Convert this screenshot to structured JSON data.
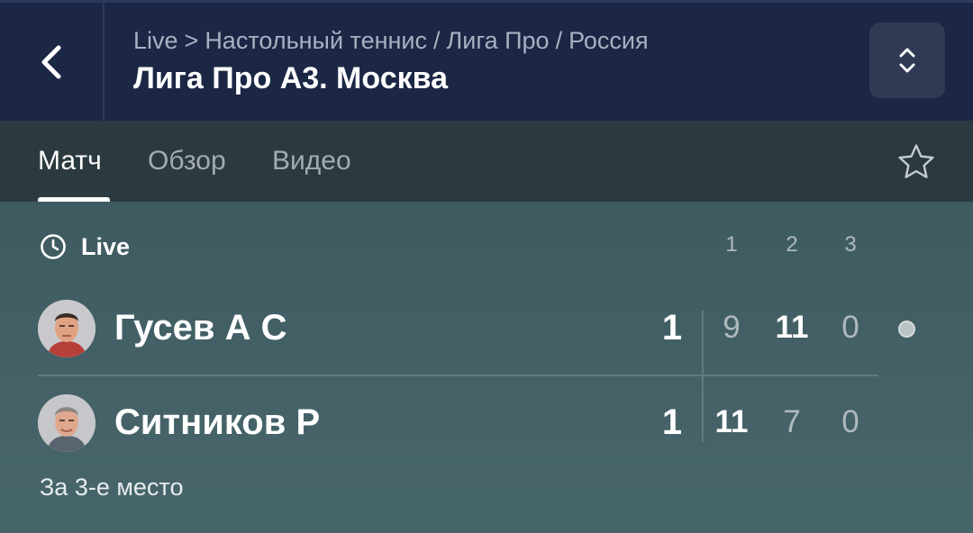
{
  "header": {
    "breadcrumb": [
      "Live",
      ">",
      "Настольный теннис",
      "/",
      "Лига Про",
      "/",
      "Россия"
    ],
    "title": "Лига Про А3. Москва"
  },
  "tabs": [
    {
      "label": "Матч",
      "active": true
    },
    {
      "label": "Обзор",
      "active": false
    },
    {
      "label": "Видео",
      "active": false
    }
  ],
  "match": {
    "status": "Live",
    "set_headers": [
      "1",
      "2",
      "3"
    ],
    "players": [
      {
        "name": "Гусев А С",
        "total": "1",
        "sets": [
          "9",
          "11",
          "0"
        ],
        "set_winner": [
          false,
          true,
          false
        ],
        "serving": true
      },
      {
        "name": "Ситников Р",
        "total": "1",
        "sets": [
          "11",
          "7",
          "0"
        ],
        "set_winner": [
          true,
          false,
          false
        ],
        "serving": false
      }
    ],
    "round": "За 3-е место"
  },
  "colors": {
    "header_bg": "#1b2744",
    "tabs_bg": "#2b3a3f",
    "panel_bg": "#46646a"
  },
  "icons": [
    "chevron-left-icon",
    "chevron-up-down-icon",
    "star-icon",
    "clock-icon",
    "serve-indicator-dot"
  ]
}
